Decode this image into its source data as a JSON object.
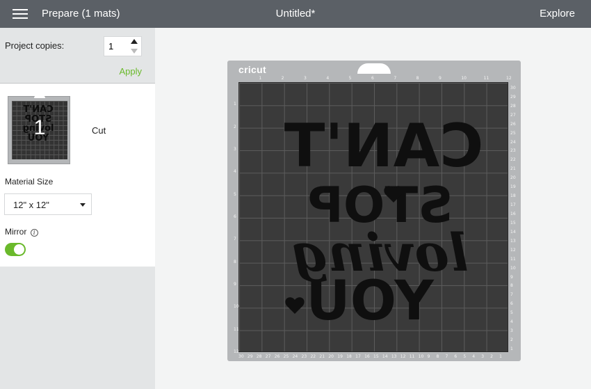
{
  "header": {
    "title": "Prepare (1 mats)",
    "project_name": "Untitled*",
    "explore_label": "Explore",
    "menu_icon": "hamburger-icon"
  },
  "sidebar": {
    "copies_label": "Project copies:",
    "copies_value": "1",
    "apply_label": "Apply",
    "mat": {
      "number": "1",
      "type": "Cut",
      "art_text": "CAN'T STOP loving YOU"
    },
    "material_size_label": "Material Size",
    "material_size_value": "12\" x 12\"",
    "mirror_label": "Mirror",
    "mirror_on": true
  },
  "mat": {
    "brand": "cricut",
    "art_lines": [
      "CAN'T",
      "STOP",
      "loving",
      "YOU"
    ],
    "top_ruler": [
      "1",
      "2",
      "3",
      "4",
      "5",
      "6",
      "7",
      "8",
      "9",
      "10",
      "11",
      "12"
    ],
    "left_ruler": [
      "1",
      "2",
      "3",
      "4",
      "5",
      "6",
      "7",
      "8",
      "9",
      "10",
      "11",
      "12"
    ],
    "right_ruler": [
      "30",
      "29",
      "28",
      "27",
      "26",
      "25",
      "24",
      "23",
      "22",
      "21",
      "20",
      "19",
      "18",
      "17",
      "16",
      "15",
      "14",
      "13",
      "12",
      "11",
      "10",
      "9",
      "8",
      "7",
      "6",
      "5",
      "4",
      "3",
      "2",
      "1"
    ],
    "bottom_ruler": [
      "30",
      "29",
      "28",
      "27",
      "26",
      "25",
      "24",
      "23",
      "22",
      "21",
      "20",
      "19",
      "18",
      "17",
      "16",
      "15",
      "14",
      "13",
      "12",
      "11",
      "10",
      "9",
      "8",
      "7",
      "6",
      "5",
      "4",
      "3",
      "2",
      "1"
    ]
  },
  "colors": {
    "header_bg": "#5b6066",
    "accent_green": "#6ab92b",
    "mat_gray": "#b5b7b9",
    "mat_grid": "#3a3a3a"
  }
}
